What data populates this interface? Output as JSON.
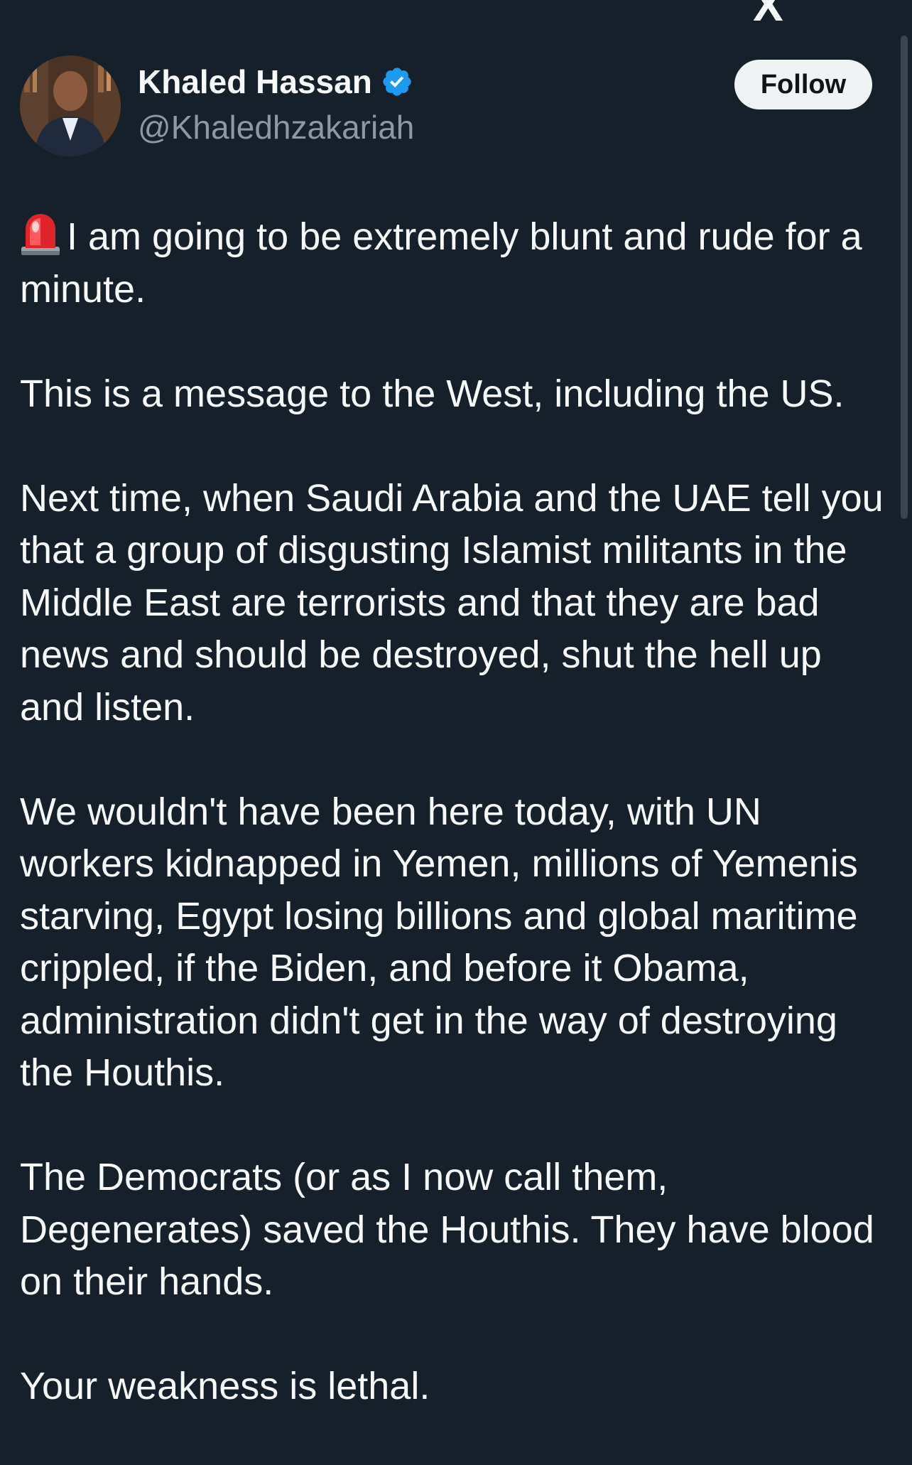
{
  "header": {
    "partial_top_text": "X",
    "display_name": "Khaled Hassan",
    "handle": "@Khaledhzakariah",
    "follow_label": "Follow"
  },
  "icons": {
    "verified": "verified-badge-icon",
    "siren": "rotating-light-emoji-icon"
  },
  "colors": {
    "background": "#15202b",
    "text": "#f7f9f9",
    "secondary_text": "#8b98a5",
    "verified_blue": "#1d9bf0",
    "follow_bg": "#eff3f4"
  },
  "post": {
    "paragraphs": [
      "I am going to be extremely blunt and rude for a minute.",
      "This is a message to the West, including the US.",
      "Next time, when Saudi Arabia and the UAE tell you that a group of disgusting Islamist militants in the Middle East are terrorists and that they are bad news and should be destroyed, shut the hell up and listen.",
      "We wouldn't have been here today, with UN workers kidnapped in Yemen, millions of Yemenis starving, Egypt losing billions and global maritime crippled, if the Biden, and before it Obama, administration didn't get in the way of destroying the Houthis.",
      "The Democrats (or as I now call them, Degenerates) saved the Houthis. They have blood on their hands.",
      "Your weakness is lethal."
    ]
  }
}
